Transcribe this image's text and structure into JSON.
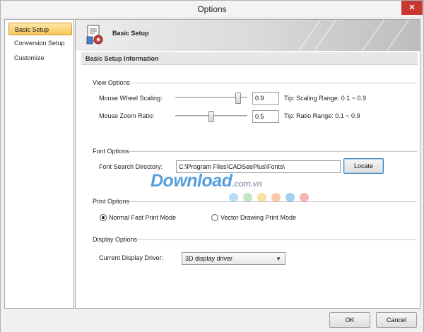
{
  "window": {
    "title": "Options",
    "close_glyph": "✕"
  },
  "sidebar": {
    "items": [
      {
        "label": "Basic Setup",
        "active": true
      },
      {
        "label": "Conversion Setup",
        "active": false
      },
      {
        "label": "Customize",
        "active": false
      }
    ]
  },
  "banner": {
    "title": "Basic Setup",
    "icon": "settings-document-icon"
  },
  "section": {
    "title": "Basic Setup Information"
  },
  "view_options": {
    "title": "View Options",
    "wheel": {
      "label": "Mouse Wheel Scaling:",
      "value": "0.9",
      "tip": "Tip: Scaling Range: 0.1 ~ 0.9",
      "level": 0.9
    },
    "zoom": {
      "label": "Mouse Zoom Ratio:",
      "value": "0.5",
      "tip": "Tip: Ratio Range: 0.1 ~ 0.9",
      "level": 0.5
    }
  },
  "font_options": {
    "title": "Font Options",
    "dir_label": "Font Search Directory:",
    "dir_value": "C:\\Program Files\\CADSeePlus\\Fonts\\",
    "locate_label": "Locate"
  },
  "print_options": {
    "title": "Print Options",
    "normal_label": "Normal Fast Print Mode",
    "vector_label": "Vector Drawing Print Mode",
    "selected": "normal"
  },
  "display_options": {
    "title": "Display Options",
    "driver_label": "Current Display Driver:",
    "driver_value": "3D display driver"
  },
  "footer": {
    "ok_label": "OK",
    "cancel_label": "Cancel"
  },
  "watermark": {
    "brand": "Download",
    "domain": ".com.vn"
  },
  "colors": {
    "accent_selected": "#f7c659",
    "close_button": "#c7372f",
    "watermark_blue": "#3a8fd6",
    "dot_colors": [
      "#7ec3ee",
      "#8fd48f",
      "#f5c65a",
      "#f59a6a",
      "#5aa6e0",
      "#f07a7a"
    ]
  }
}
